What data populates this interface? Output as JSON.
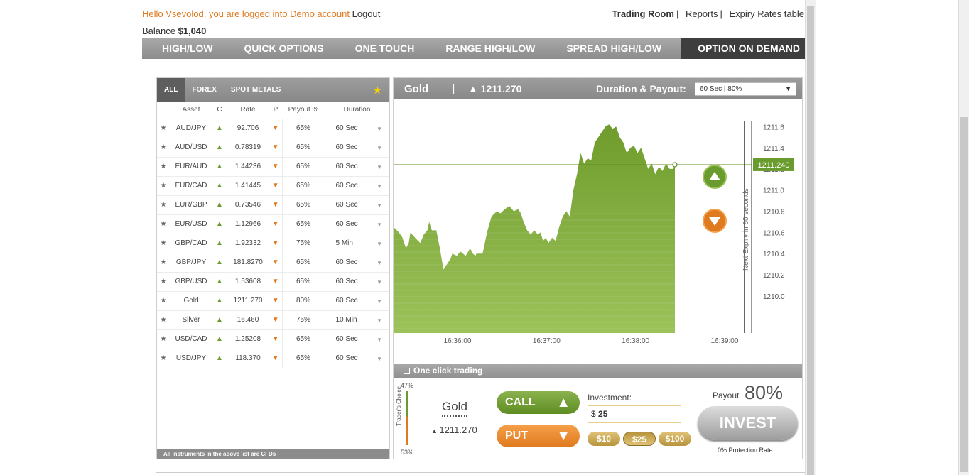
{
  "header": {
    "greeting": "Hello Vsevolod, you are logged into Demo account",
    "logout": "Logout",
    "balance_label": "Balance",
    "balance_value": "$1,040",
    "nav": [
      "Trading Room",
      "Reports",
      "Expiry Rates table"
    ]
  },
  "tabs": [
    "HIGH/LOW",
    "QUICK OPTIONS",
    "ONE TOUCH",
    "RANGE HIGH/LOW",
    "SPREAD HIGH/LOW",
    "OPTION ON DEMAND"
  ],
  "asset_panel": {
    "tabs": [
      "ALL",
      "FOREX",
      "SPOT METALS"
    ],
    "columns": [
      "Asset",
      "C",
      "Rate",
      "P",
      "Payout %",
      "Duration"
    ],
    "rows": [
      {
        "asset": "AUD/JPY",
        "rate": "92.706",
        "payout": "65%",
        "duration": "60 Sec"
      },
      {
        "asset": "AUD/USD",
        "rate": "0.78319",
        "payout": "65%",
        "duration": "60 Sec"
      },
      {
        "asset": "EUR/AUD",
        "rate": "1.44236",
        "payout": "65%",
        "duration": "60 Sec"
      },
      {
        "asset": "EUR/CAD",
        "rate": "1.41445",
        "payout": "65%",
        "duration": "60 Sec"
      },
      {
        "asset": "EUR/GBP",
        "rate": "0.73546",
        "payout": "65%",
        "duration": "60 Sec"
      },
      {
        "asset": "EUR/USD",
        "rate": "1.12966",
        "payout": "65%",
        "duration": "60 Sec"
      },
      {
        "asset": "GBP/CAD",
        "rate": "1.92332",
        "payout": "75%",
        "duration": "5 Min"
      },
      {
        "asset": "GBP/JPY",
        "rate": "181.8270",
        "payout": "65%",
        "duration": "60 Sec"
      },
      {
        "asset": "GBP/USD",
        "rate": "1.53608",
        "payout": "65%",
        "duration": "60 Sec"
      },
      {
        "asset": "Gold",
        "rate": "1211.270",
        "payout": "80%",
        "duration": "60 Sec"
      },
      {
        "asset": "Silver",
        "rate": "16.460",
        "payout": "75%",
        "duration": "10 Min"
      },
      {
        "asset": "USD/CAD",
        "rate": "1.25208",
        "payout": "65%",
        "duration": "60 Sec"
      },
      {
        "asset": "USD/JPY",
        "rate": "118.370",
        "payout": "65%",
        "duration": "60 Sec"
      }
    ],
    "footer": "All instruments in the above list are CFDs"
  },
  "chart_panel": {
    "asset": "Gold",
    "separator": "|",
    "price": "1211.270",
    "duration_label": "Duration & Payout:",
    "duration_value": "60 Sec | 80%",
    "current_price_tag": "1211.240",
    "expiry_text": "Next Expiry in 60 seconds",
    "one_click": "One click trading"
  },
  "chart_data": {
    "type": "area",
    "x_ticks": [
      "16:36:00",
      "16:37:00",
      "16:38:00",
      "16:39:00"
    ],
    "y_ticks": [
      "1211.6",
      "1211.4",
      "1211.2",
      "1211.0",
      "1210.8",
      "1210.6",
      "1210.4",
      "1210.2",
      "1210.0"
    ],
    "ylim": [
      1209.65,
      1211.85
    ],
    "current_value": 1211.24,
    "series": [
      {
        "x": [
          0,
          0.06,
          0.1,
          0.14,
          0.17,
          0.19,
          0.24,
          0.3,
          0.34,
          0.38,
          0.4,
          0.43,
          0.48,
          0.52,
          0.56,
          0.6,
          0.64,
          0.66,
          0.71,
          0.75,
          0.81,
          0.86,
          0.89,
          0.92,
          0.93,
          1.0,
          1.05,
          1.1,
          1.16,
          1.2,
          1.25,
          1.3,
          1.35,
          1.4,
          1.43,
          1.46,
          1.5,
          1.54,
          1.58,
          1.62,
          1.65,
          1.68,
          1.71,
          1.74,
          1.78,
          1.82,
          1.86,
          1.9,
          1.94,
          1.98,
          2.02,
          2.06,
          2.1,
          2.14,
          2.18,
          2.22,
          2.26,
          2.3,
          2.34,
          2.38,
          2.42,
          2.46,
          2.5,
          2.54,
          2.58,
          2.62,
          2.66,
          2.7,
          2.74,
          2.78,
          2.82,
          2.86,
          2.9,
          2.94,
          2.98,
          3.02,
          3.06,
          3.1,
          3.14,
          3.16
        ],
        "y": [
          1210.65,
          1210.6,
          1210.55,
          1210.45,
          1210.5,
          1210.6,
          1210.55,
          1210.5,
          1210.58,
          1210.62,
          1210.7,
          1210.62,
          1210.62,
          1210.45,
          1210.25,
          1210.3,
          1210.35,
          1210.4,
          1210.38,
          1210.42,
          1210.38,
          1210.45,
          1210.4,
          1210.38,
          1210.4,
          1210.4,
          1210.6,
          1210.75,
          1210.8,
          1210.78,
          1210.82,
          1210.85,
          1210.8,
          1210.82,
          1210.78,
          1210.7,
          1210.62,
          1210.58,
          1210.62,
          1210.58,
          1210.6,
          1210.52,
          1210.55,
          1210.5,
          1210.55,
          1210.52,
          1210.65,
          1210.75,
          1210.8,
          1210.75,
          1211.0,
          1211.15,
          1211.35,
          1211.25,
          1211.3,
          1211.28,
          1211.45,
          1211.5,
          1211.55,
          1211.6,
          1211.62,
          1211.58,
          1211.6,
          1211.5,
          1211.45,
          1211.35,
          1211.4,
          1211.42,
          1211.35,
          1211.4,
          1211.3,
          1211.2,
          1211.25,
          1211.15,
          1211.22,
          1211.18,
          1211.25,
          1211.2,
          1211.2,
          1211.24
        ]
      }
    ]
  },
  "trade": {
    "traders_choice": "Trader's Choice",
    "up_pct": "47%",
    "down_pct": "53%",
    "asset": "Gold",
    "price": "1211.270",
    "call": "CALL",
    "put": "PUT",
    "investment_label": "Investment:",
    "currency": "$",
    "investment_value": "25",
    "quick_amounts": [
      "$10",
      "$25",
      "$100"
    ],
    "payout_label": "Payout",
    "payout_value": "80%",
    "invest": "INVEST",
    "protection": "0% Protection Rate"
  },
  "colors": {
    "call_green": "#6a9b2e",
    "put_orange": "#e07a1f",
    "area_green": "#7faa3a",
    "header_gray": "#8c8c8c"
  }
}
